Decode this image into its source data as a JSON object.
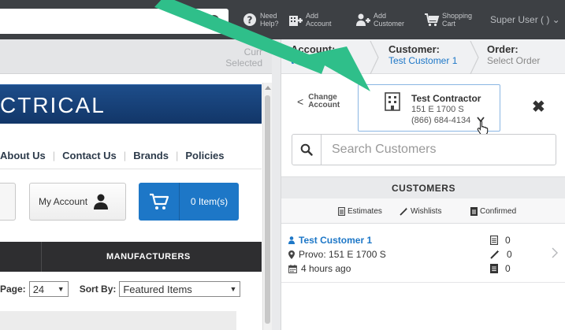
{
  "header": {
    "help": {
      "line1": "Need",
      "line2": "Help?"
    },
    "add_account": {
      "line1": "Add",
      "line2": "Account"
    },
    "add_customer": {
      "line1": "Add",
      "line2": "Customer"
    },
    "shopping_cart": {
      "line1": "Shopping",
      "line2": "Cart"
    },
    "user_menu_label": "Super User ( ) ⌄"
  },
  "store": {
    "context_label_line1": "Curr",
    "context_label_line2": "Selected",
    "banner_text": "CTRICAL",
    "nav_links": [
      "About Us",
      "Contact Us",
      "Brands",
      "Policies"
    ],
    "my_account_label": "My Account",
    "cart_count_label": "0 Item(s)",
    "category_label": "MANUFACTURERS",
    "page_size_label": "Page:",
    "page_size_value": "24",
    "sort_label": "Sort By:",
    "sort_value": "Featured Items"
  },
  "panel": {
    "breadcrumbs": [
      {
        "title": "Account:",
        "value": "t Contractor",
        "active": true
      },
      {
        "title": "Customer:",
        "value": "Test Customer 1",
        "active": true
      },
      {
        "title": "Order:",
        "value": "Select Order",
        "active": false
      }
    ],
    "change_account_line1": "Change",
    "change_account_line2": "Account",
    "account": {
      "name": "Test Contractor",
      "address": "151 E 1700 S",
      "phone": "(866) 684-4134"
    },
    "search_placeholder": "Search Customers",
    "customers_header": "CUSTOMERS",
    "legend": {
      "estimates": "Estimates",
      "wishlists": "Wishlists",
      "confirmed": "Confirmed"
    },
    "customers": [
      {
        "name": "Test Customer 1",
        "location": "Provo: 151 E 1700 S",
        "time": "4 hours ago",
        "estimates": "0",
        "wishlists": "0",
        "confirmed": "0"
      }
    ]
  },
  "colors": {
    "accent": "#1d77c7",
    "arrow": "#2fbf8a",
    "topbar": "#3d4044",
    "banner": "#1d4d8a"
  }
}
